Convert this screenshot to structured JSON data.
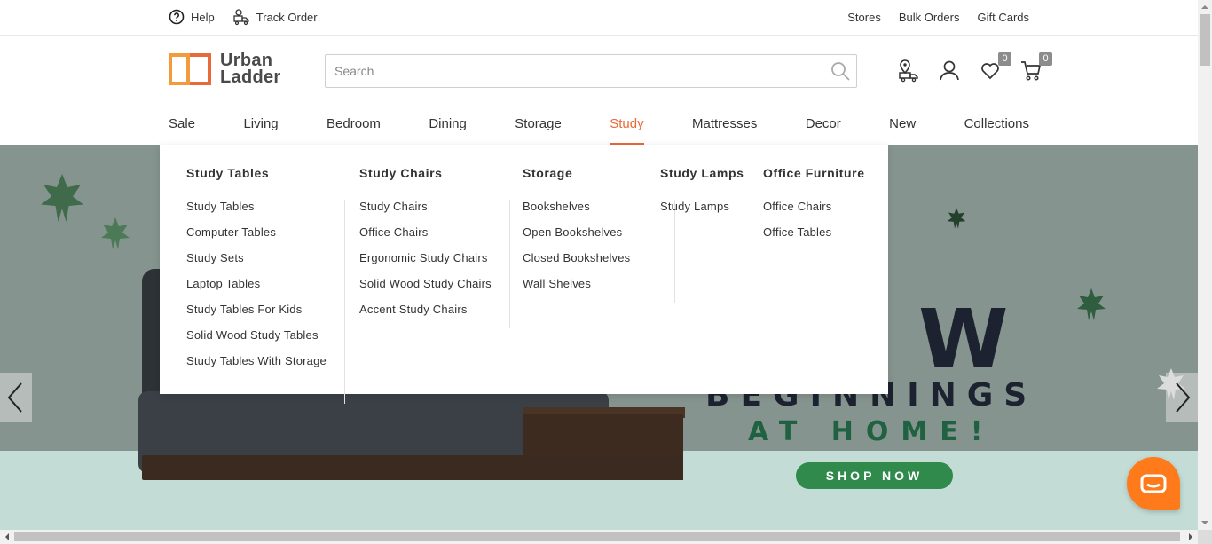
{
  "topbar": {
    "help_label": "Help",
    "track_order_label": "Track Order",
    "links": [
      "Stores",
      "Bulk Orders",
      "Gift Cards"
    ]
  },
  "brand": {
    "name_line1": "Urban",
    "name_line2": "Ladder",
    "accent_color": "#e86a3a"
  },
  "search": {
    "placeholder": "Search",
    "value": ""
  },
  "header_icons": {
    "wishlist_count": "0",
    "cart_count": "0"
  },
  "nav": {
    "items": [
      "Sale",
      "Living",
      "Bedroom",
      "Dining",
      "Storage",
      "Study",
      "Mattresses",
      "Decor",
      "New",
      "Collections"
    ],
    "active": "Study"
  },
  "mega_menu": {
    "columns": [
      {
        "title": "Study Tables",
        "items": [
          "Study Tables",
          "Computer Tables",
          "Study Sets",
          "Laptop Tables",
          "Study Tables For Kids",
          "Solid Wood Study Tables",
          "Study Tables With Storage"
        ]
      },
      {
        "title": "Study Chairs",
        "items": [
          "Study Chairs",
          "Office Chairs",
          "Ergonomic Study Chairs",
          "Solid Wood Study Chairs",
          "Accent Study Chairs"
        ]
      },
      {
        "title": "Storage",
        "items": [
          "Bookshelves",
          "Open Bookshelves",
          "Closed Bookshelves",
          "Wall Shelves"
        ]
      },
      {
        "title": "Study Lamps",
        "items": [
          "Study Lamps"
        ]
      },
      {
        "title": "Office Furniture",
        "items": [
          "Office Chairs",
          "Office Tables"
        ]
      }
    ]
  },
  "hero": {
    "headline_big": "W",
    "line1": "BEGINNINGS",
    "line2": "AT HOME!",
    "cta_label": "SHOP NOW",
    "cta_color": "#2f8a4c"
  }
}
